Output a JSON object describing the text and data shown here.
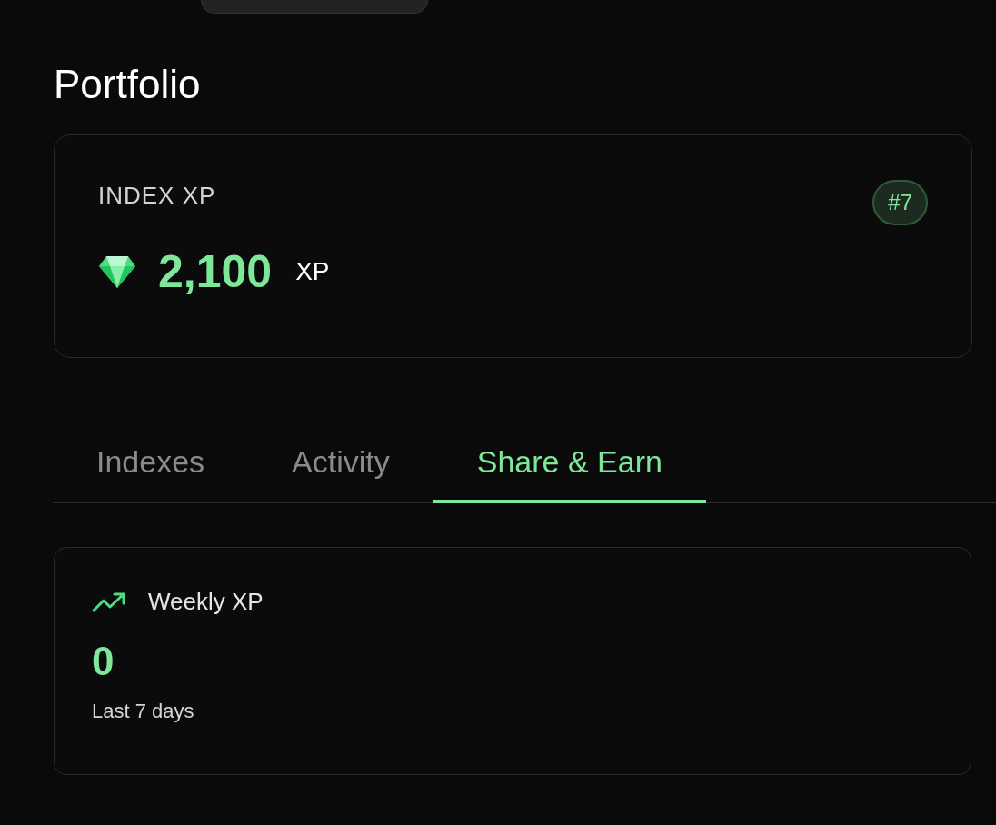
{
  "title": "Portfolio",
  "xp_card": {
    "label": "INDEX XP",
    "rank": "#7",
    "amount": "2,100",
    "unit": "XP"
  },
  "tabs": [
    {
      "label": "Indexes",
      "selected": false
    },
    {
      "label": "Activity",
      "selected": false
    },
    {
      "label": "Share & Earn",
      "selected": true
    }
  ],
  "weekly_card": {
    "label": "Weekly XP",
    "value": "0",
    "caption": "Last 7 days"
  }
}
